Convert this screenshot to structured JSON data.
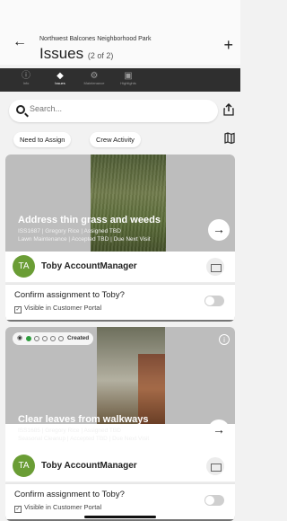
{
  "header": {
    "park_name": "Northwest Balcones Neighborhood Park",
    "title": "Issues",
    "count": "(2 of 2)"
  },
  "tabs": [
    {
      "label": "Info",
      "icon": "info-icon"
    },
    {
      "label": "Issues",
      "icon": "diamond-icon"
    },
    {
      "label": "Maintenance",
      "icon": "gear-icon"
    },
    {
      "label": "Highlights",
      "icon": "photo-icon"
    }
  ],
  "search": {
    "placeholder": "Search..."
  },
  "filters": [
    "Need to Assign",
    "Crew Activity"
  ],
  "issues": [
    {
      "title": "Address thin grass and weeds",
      "meta1": "ISS1687 | Gregory Rice | Assigned TBD",
      "meta2": "Lawn Maintenance | Accepted TBD | Due Next Visit",
      "assignee_initials": "TA",
      "assignee_name": "Toby AccountManager",
      "confirm": "Confirm assignment to Toby?",
      "portal": "Visible in Customer Portal"
    },
    {
      "status": "Created",
      "title": "Clear leaves from walkways",
      "meta1": "ISS1685 | Gregory Rice | Assigned TBD",
      "meta2": "Seasonal Cleanup | Accepted TBD | Due Next Visit",
      "assignee_initials": "TA",
      "assignee_name": "Toby AccountManager",
      "confirm": "Confirm assignment to Toby?",
      "portal": "Visible in Customer Portal"
    }
  ],
  "colors": {
    "avatar": "#6a9d35",
    "status_dot": "#2e9d3d",
    "tabbar": "#2f2f2f"
  }
}
